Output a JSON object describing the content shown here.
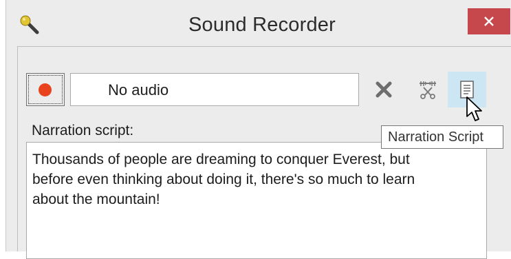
{
  "window": {
    "title": "Sound Recorder",
    "app_icon": "microphone-icon",
    "close_icon": "close-icon",
    "close_color": "#c7484c"
  },
  "toolbar": {
    "record_icon": "record-icon",
    "record_color": "#e9431d",
    "audio_status": "No audio",
    "delete_icon": "delete-icon",
    "trim_icon": "trim-audio-icon",
    "script_icon": "narration-script-icon"
  },
  "narration": {
    "label": "Narration script:",
    "text": "Thousands of people are dreaming to conquer Everest, but\nbefore even thinking about doing it, there's so much to learn\nabout the mountain!"
  },
  "tooltip": {
    "text": "Narration Script"
  },
  "cursor": {
    "icon": "mouse-pointer-icon"
  }
}
